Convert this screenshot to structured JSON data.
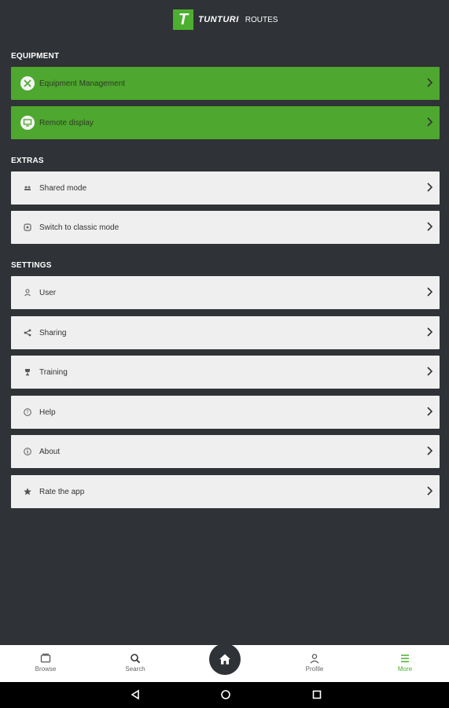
{
  "brand": {
    "name": "TUNTURI",
    "sub": "ROUTES",
    "mark": "T"
  },
  "sections": {
    "equipment": {
      "title": "EQUIPMENT",
      "items": [
        {
          "label": "Equipment Management",
          "icon": "tools-icon"
        },
        {
          "label": "Remote display",
          "icon": "monitor-icon"
        }
      ]
    },
    "extras": {
      "title": "EXTRAS",
      "items": [
        {
          "label": "Shared mode",
          "icon": "group-icon"
        },
        {
          "label": "Switch to classic mode",
          "icon": "switch-icon"
        }
      ]
    },
    "settings": {
      "title": "SETTINGS",
      "items": [
        {
          "label": "User",
          "icon": "user-icon"
        },
        {
          "label": "Sharing",
          "icon": "share-icon"
        },
        {
          "label": "Training",
          "icon": "trophy-icon"
        },
        {
          "label": "Help",
          "icon": "help-icon"
        },
        {
          "label": "About",
          "icon": "info-icon"
        },
        {
          "label": "Rate the app",
          "icon": "star-icon"
        }
      ]
    }
  },
  "bottom_nav": {
    "items": [
      {
        "label": "Browse",
        "icon": "browse-icon"
      },
      {
        "label": "Search",
        "icon": "search-icon"
      },
      {
        "label": "Profile",
        "icon": "profile-icon"
      },
      {
        "label": "More",
        "icon": "menu-icon",
        "active": true
      }
    ],
    "home_icon": "home-icon"
  },
  "colors": {
    "background": "#2f3236",
    "accent": "#4ea72e",
    "row": "#efefef"
  }
}
